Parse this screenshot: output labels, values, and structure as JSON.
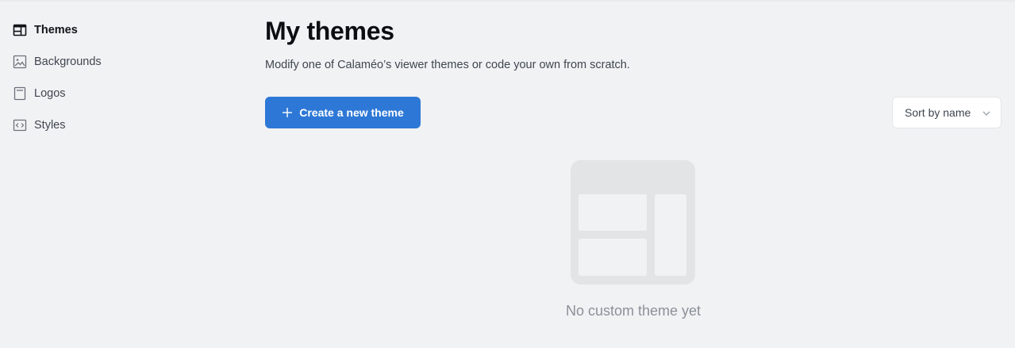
{
  "sidebar": {
    "items": [
      {
        "label": "Themes",
        "icon": "layout-icon",
        "active": true
      },
      {
        "label": "Backgrounds",
        "icon": "image-icon",
        "active": false
      },
      {
        "label": "Logos",
        "icon": "logo-frame-icon",
        "active": false
      },
      {
        "label": "Styles",
        "icon": "code-icon",
        "active": false
      }
    ]
  },
  "main": {
    "title": "My themes",
    "subtitle": "Modify one of Calaméo’s viewer themes or code your own from scratch.",
    "create_button": {
      "label": "Create a new theme",
      "icon": "plus-icon"
    },
    "sort": {
      "selected": "Sort by name",
      "icon": "chevron-down-icon"
    },
    "empty_state": {
      "text": "No custom theme yet",
      "icon": "theme-layout-illustration"
    }
  },
  "colors": {
    "background": "#f1f2f4",
    "accent": "#2d78d6",
    "title": "#0c0e11",
    "muted": "#8b9098",
    "illustration": "#e3e4e6"
  }
}
